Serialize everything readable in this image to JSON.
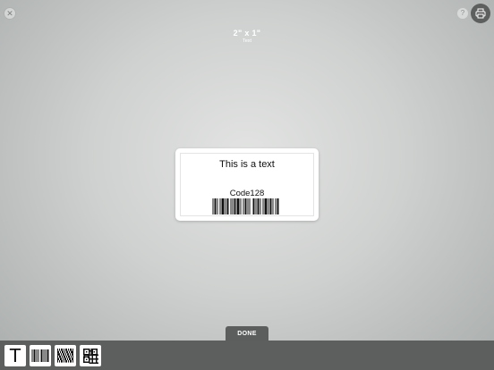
{
  "header": {
    "title": "2\" x 1\"",
    "subtitle": "Text",
    "close_icon": "close-icon",
    "help_icon": "help-icon",
    "print_icon": "printer-icon",
    "close_glyph": "✕",
    "help_glyph": "?"
  },
  "label": {
    "text": "This is a text",
    "barcode_caption": "Code128"
  },
  "done_button": {
    "label": "DONE"
  },
  "toolbar": {
    "items": [
      {
        "name": "text-tool",
        "glyph": "T"
      },
      {
        "name": "barcode-tool"
      },
      {
        "name": "pdf417-tool"
      },
      {
        "name": "qr-code-tool"
      }
    ]
  },
  "colors": {
    "toolbar": "#5c5f5e",
    "background": "#d0d2d1",
    "label": "#ffffff"
  }
}
